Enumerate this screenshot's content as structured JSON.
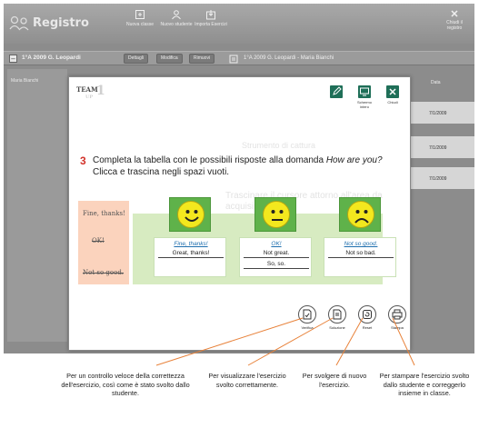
{
  "app": {
    "title": "Registro",
    "toolbar": [
      {
        "label": "Nuova classe",
        "icon": "new-class-icon"
      },
      {
        "label": "Nuovo studente",
        "icon": "new-student-icon"
      },
      {
        "label": "Importa Esercizi",
        "icon": "import-icon"
      }
    ],
    "close_all": "Chiudi il registro"
  },
  "subbar": {
    "class_name": "1°A 2009 G. Leopardi",
    "buttons": [
      "Dettagli",
      "Modifica",
      "Rimuovi"
    ],
    "student_path": "1°A 2009 G. Leopardi - Maria Bianchi"
  },
  "student_list": {
    "first_name": "Maria Bianchi"
  },
  "records": {
    "date_header": "Data",
    "dates": [
      "7/1/2009",
      "7/1/2009",
      "7/1/2009"
    ]
  },
  "modal": {
    "logo_top": "TEAM",
    "logo_sub": "UP",
    "logo_num": "1",
    "tools": [
      {
        "label": "",
        "icon": "pencil-icon"
      },
      {
        "label": "Schermo intero",
        "icon": "screen-icon"
      },
      {
        "label": "Chiudi",
        "icon": "close-icon"
      }
    ],
    "question_number": "3",
    "question_text": "Completa la tabella con le possibili risposte alla domanda",
    "question_italic": "How are you?",
    "question_text2": "Clicca e trascina negli spazi vuoti.",
    "ghost_tool": "Strumento di cattura",
    "ghost_hint": "Trascinare il cursore attorno all'area da acquisire.",
    "source_items": [
      "Fine, thanks!",
      "OK!",
      "Not so good."
    ],
    "columns": [
      {
        "mood": "happy",
        "answer": "Fine, thanks!",
        "cells": [
          "Great, thanks!"
        ]
      },
      {
        "mood": "neutral",
        "answer": "OK!",
        "cells": [
          "Not great.",
          "So, so."
        ]
      },
      {
        "mood": "sad",
        "answer": "Not so good.",
        "cells": [
          "Not so bad."
        ]
      }
    ],
    "actions": [
      {
        "label": "Verifica",
        "icon": "verify-icon"
      },
      {
        "label": "Soluzione",
        "icon": "solution-icon"
      },
      {
        "label": "Reset",
        "icon": "reset-icon"
      },
      {
        "label": "Stampa",
        "icon": "print-icon"
      }
    ]
  },
  "callouts": [
    "Per un controllo veloce della correttezza dell'esercizio, così come è stato svolto dallo studente.",
    "Per visualizzare l'esercizio svolto correttamente.",
    "Per svolgere di nuovo l'esercizio.",
    "Per stampare l'esercizio svolto dallo studente e correggerlo insieme in classe."
  ],
  "colors": {
    "accent_orange": "#e8823a",
    "brand_green": "#1f6f58",
    "number_red": "#d2322a"
  }
}
